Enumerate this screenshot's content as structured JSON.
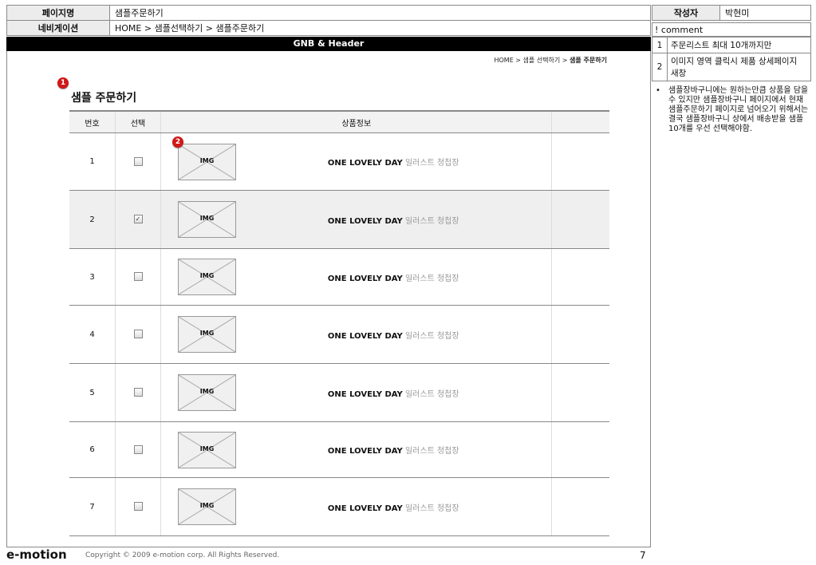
{
  "header": {
    "page_name_label": "페이지명",
    "page_name": "샘플주문하기",
    "nav_label": "네비게이션",
    "nav_value": "HOME > 샘플선택하기 > 샘플주문하기",
    "author_label": "작성자",
    "author": "박현미"
  },
  "comments": {
    "title": "! comment",
    "items": [
      {
        "num": "1",
        "text": "주문리스트 최대 10개까지만"
      },
      {
        "num": "2",
        "text": "이미지 영역 클릭시 제품 상세페이지 새창"
      }
    ],
    "note_bullet": "•",
    "note": "샘플장바구니에는 원하는만큼 상품을 담을 수 있지만 샘플장바구니 페이지에서 현재 샘플주문하기 페이지로 넘어오기 위해서는 결국 샘플장바구니 상에서 배송받을 샘플 10개를 우선 선택해야함."
  },
  "gnb": "GNB & Header",
  "breadcrumb": {
    "prefix": "HOME > 샘플 선택하기 > ",
    "current": "샘플 주문하기"
  },
  "page_title": "샘플  주문하기",
  "badges": [
    "1",
    "2"
  ],
  "table": {
    "headers": [
      "번호",
      "선택",
      "상품정보",
      ""
    ],
    "img_label": "IMG",
    "rows": [
      {
        "num": "1",
        "checked": false,
        "name": "ONE LOVELY DAY",
        "sub": "일러스트 청첩장"
      },
      {
        "num": "2",
        "checked": true,
        "name": "ONE LOVELY DAY",
        "sub": "일러스트 청첩장"
      },
      {
        "num": "3",
        "checked": false,
        "name": "ONE LOVELY DAY",
        "sub": "일러스트 청첩장"
      },
      {
        "num": "4",
        "checked": false,
        "name": "ONE LOVELY DAY",
        "sub": "일러스트 청첩장"
      },
      {
        "num": "5",
        "checked": false,
        "name": "ONE LOVELY DAY",
        "sub": "일러스트 청첩장"
      },
      {
        "num": "6",
        "checked": false,
        "name": "ONE LOVELY DAY",
        "sub": "일러스트 청첩장"
      },
      {
        "num": "7",
        "checked": false,
        "name": "ONE LOVELY DAY",
        "sub": "일러스트 청첩장"
      }
    ]
  },
  "footer": {
    "logo": "e-motion",
    "copyright": "Copyright © 2009 e-motion corp. All Rights Reserved.",
    "page_number": "7"
  }
}
